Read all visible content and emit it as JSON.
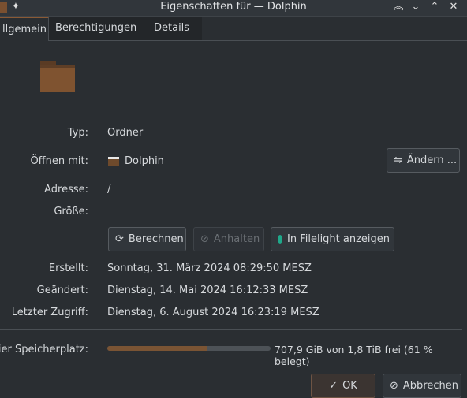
{
  "window": {
    "title": "Eigenschaften für — Dolphin",
    "icons": [
      "folder-icon",
      "pin-icon",
      "keep-above-icon",
      "minimize-icon",
      "maximize-icon",
      "close-icon"
    ]
  },
  "tabs": [
    {
      "label": "llgemein",
      "active": true
    },
    {
      "label": "Berechtigungen"
    },
    {
      "label": "Details"
    }
  ],
  "fields": {
    "type_label": "Typ:",
    "type_value": "Ordner",
    "open_label": "Öffnen mit:",
    "open_value": "Dolphin",
    "change_button": "Ändern ...",
    "address_label": "Adresse:",
    "address_value": "/",
    "size_label": "Größe:",
    "calc_button": "Berechnen",
    "stop_button": "Anhalten",
    "filelight_button": "In Filelight anzeigen",
    "created_label": "Erstellt:",
    "created_value": "Sonntag, 31. März 2024 08:29:50 MESZ",
    "modified_label": "Geändert:",
    "modified_value": "Dienstag, 14. Mai 2024 16:12:33 MESZ",
    "accessed_label": "Letzter Zugriff:",
    "accessed_value": "Dienstag, 6. August 2024 16:23:19 MESZ",
    "free_label": "eier Speicherplatz:",
    "free_value": "707,9 GiB von 1,8 TiB frei (61 % belegt)",
    "used_percent": 61
  },
  "footer": {
    "ok": "OK",
    "cancel": "Abbrechen"
  },
  "colors": {
    "accent": "#8a5a35",
    "folder": "#7a5030",
    "filelight": "#1fa88a"
  }
}
